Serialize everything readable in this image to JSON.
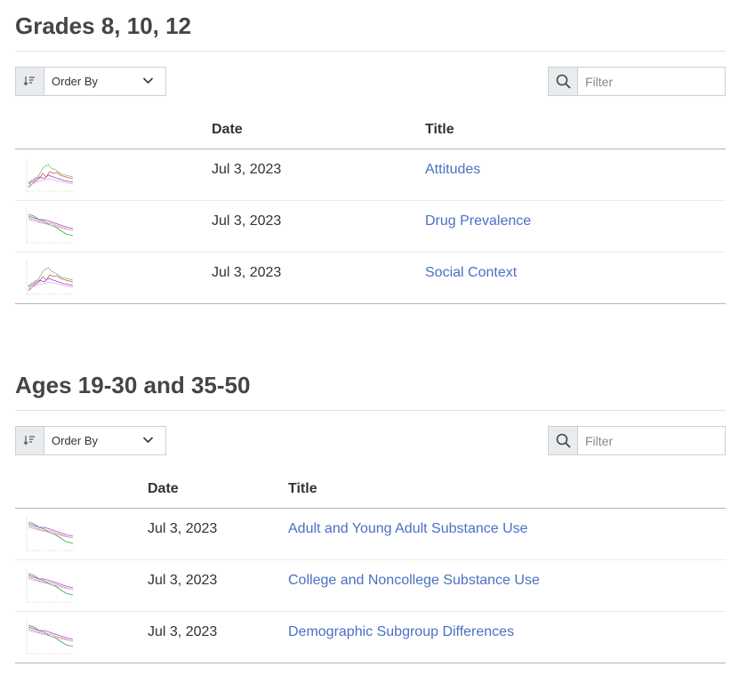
{
  "sections": [
    {
      "title": "Grades 8, 10, 12",
      "order_by_label": "Order By",
      "filter_placeholder": "Filter",
      "columns": {
        "date": "Date",
        "title": "Title"
      },
      "rows": [
        {
          "date": "Jul 3, 2023",
          "title": "Attitudes",
          "thumb": "chart-thumbnail-a"
        },
        {
          "date": "Jul 3, 2023",
          "title": "Drug Prevalence",
          "thumb": "chart-thumbnail-b"
        },
        {
          "date": "Jul 3, 2023",
          "title": "Social Context",
          "thumb": "chart-thumbnail-a"
        }
      ]
    },
    {
      "title": "Ages 19-30 and 35-50",
      "order_by_label": "Order By",
      "filter_placeholder": "Filter",
      "columns": {
        "date": "Date",
        "title": "Title"
      },
      "rows": [
        {
          "date": "Jul 3, 2023",
          "title": "Adult and Young Adult Substance Use",
          "thumb": "chart-thumbnail-b"
        },
        {
          "date": "Jul 3, 2023",
          "title": "College and Noncollege Substance Use",
          "thumb": "chart-thumbnail-b"
        },
        {
          "date": "Jul 3, 2023",
          "title": "Demographic Subgroup Differences",
          "thumb": "chart-thumbnail-b"
        }
      ]
    }
  ],
  "colors": {
    "link": "#4a70c4",
    "heading": "#454545",
    "control_bg": "#e9ecef"
  },
  "icons": {
    "sort": "sort-icon",
    "dropdown": "chevron-down-icon",
    "search": "search-icon"
  }
}
